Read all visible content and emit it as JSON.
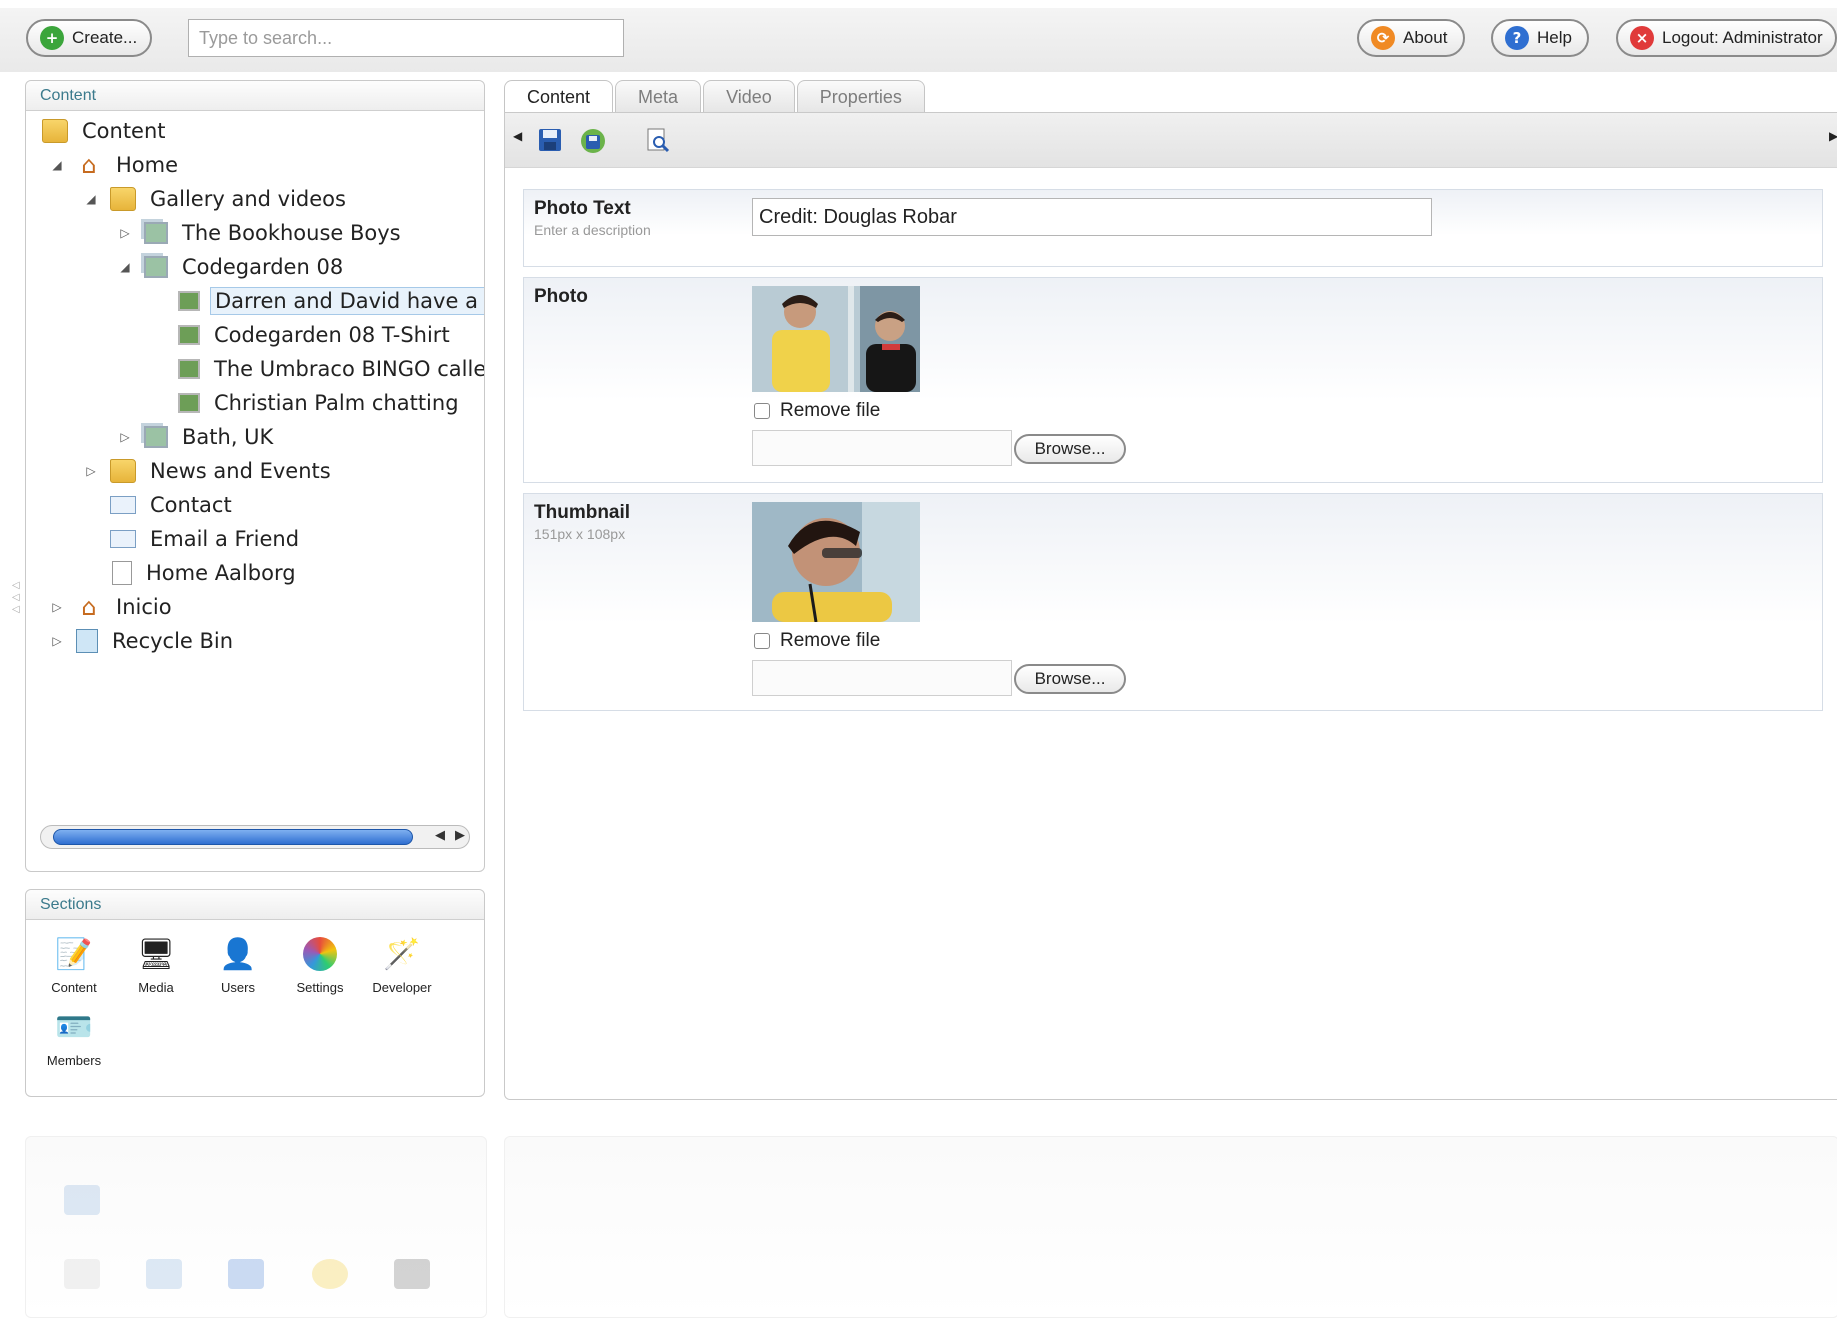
{
  "topbar": {
    "create_label": "Create...",
    "search_placeholder": "Type to search...",
    "about_label": "About",
    "help_label": "Help",
    "logout_label": "Logout: Administrator"
  },
  "content_panel": {
    "title": "Content",
    "tree": [
      {
        "label": "Content",
        "icon": "folder-icon",
        "toggle": ""
      },
      {
        "label": "Home",
        "icon": "home-icon",
        "toggle": "expanded"
      },
      {
        "label": "Gallery and videos",
        "icon": "folder-icon",
        "toggle": "expanded"
      },
      {
        "label": "The Bookhouse Boys",
        "icon": "gallery-icon",
        "toggle": "collapsed"
      },
      {
        "label": "Codegarden 08",
        "icon": "gallery-icon",
        "toggle": "expanded"
      },
      {
        "label": "Darren and David have a ch",
        "icon": "photo-icon",
        "toggle": "",
        "selected": true
      },
      {
        "label": "Codegarden 08 T-Shirt",
        "icon": "photo-icon",
        "toggle": ""
      },
      {
        "label": "The Umbraco BINGO callers",
        "icon": "photo-icon",
        "toggle": ""
      },
      {
        "label": "Christian Palm chatting",
        "icon": "photo-icon",
        "toggle": ""
      },
      {
        "label": "Bath, UK",
        "icon": "gallery-icon",
        "toggle": "collapsed"
      },
      {
        "label": "News and Events",
        "icon": "folder-icon",
        "toggle": "collapsed"
      },
      {
        "label": "Contact",
        "icon": "mail-icon",
        "toggle": ""
      },
      {
        "label": "Email a Friend",
        "icon": "mail-forward-icon",
        "toggle": ""
      },
      {
        "label": "Home Aalborg",
        "icon": "document-icon",
        "toggle": ""
      },
      {
        "label": "Inicio",
        "icon": "home-icon",
        "toggle": "collapsed"
      },
      {
        "label": "Recycle Bin",
        "icon": "recycle-bin-icon",
        "toggle": "collapsed"
      }
    ]
  },
  "sections_panel": {
    "title": "Sections",
    "items": [
      {
        "label": "Content",
        "icon": "pencil-page-icon"
      },
      {
        "label": "Media",
        "icon": "monitor-icon"
      },
      {
        "label": "Users",
        "icon": "user-icon"
      },
      {
        "label": "Settings",
        "icon": "color-wheel-icon"
      },
      {
        "label": "Developer",
        "icon": "magic-wand-icon"
      },
      {
        "label": "Members",
        "icon": "member-card-icon"
      }
    ]
  },
  "editor": {
    "tabs": [
      {
        "label": "Content",
        "active": true
      },
      {
        "label": "Meta",
        "active": false
      },
      {
        "label": "Video",
        "active": false
      },
      {
        "label": "Properties",
        "active": false
      }
    ],
    "toolbar": {
      "icons": [
        "save-icon",
        "save-publish-icon",
        "preview-icon"
      ]
    },
    "photo_text": {
      "title": "Photo Text",
      "description": "Enter a description",
      "value": "Credit: Douglas Robar"
    },
    "photo": {
      "title": "Photo",
      "remove_label": "Remove file",
      "browse_label": "Browse..."
    },
    "thumbnail": {
      "title": "Thumbnail",
      "description": "151px x 108px",
      "remove_label": "Remove file",
      "browse_label": "Browse..."
    }
  },
  "colors": {
    "panel_title": "#3b7a8c",
    "selection_bg": "#e8f2fb",
    "scroll_thumb": "#2f6fd1",
    "about_icon": "#f08a24",
    "help_icon": "#2f6fd1",
    "logout_icon": "#e03a3a",
    "create_icon": "#3ba53b"
  }
}
